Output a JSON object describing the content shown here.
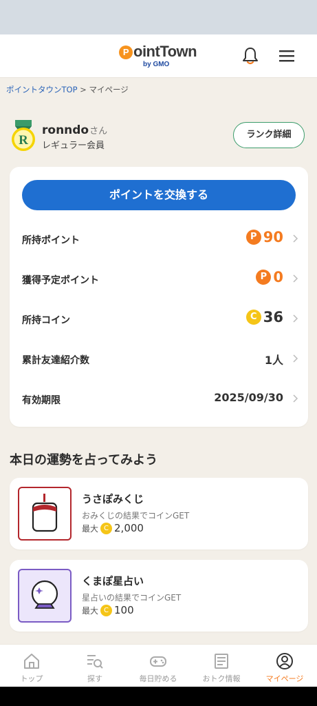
{
  "header": {
    "logo_main": "ointTown",
    "logo_p": "P",
    "logo_sub": "by GMO",
    "bell_icon": "bell-icon",
    "menu_icon": "hamburger-menu-icon"
  },
  "breadcrumb": {
    "home": "ポイントタウンTOP",
    "separator": " > ",
    "current": "マイページ"
  },
  "profile": {
    "badge_letter": "R",
    "name": "ronndo",
    "suffix": "さん",
    "rank": "レギュラー会員",
    "rank_button": "ランク詳細"
  },
  "points": {
    "exchange_button": "ポイントを交換する",
    "rows": [
      {
        "label": "所持ポイント",
        "value": "90",
        "unit_icon": "point-coin-icon"
      },
      {
        "label": "獲得予定ポイント",
        "value": "0",
        "unit_icon": "point-coin-icon"
      },
      {
        "label": "所持コイン",
        "value": "36",
        "unit_icon": "coin-icon"
      },
      {
        "label": "累計友達紹介数",
        "value": "1人"
      },
      {
        "label": "有効期限",
        "value": "2025/09/30"
      }
    ],
    "point_badge": "P",
    "coin_badge": "C"
  },
  "fortune": {
    "title": "本日の運勢を占ってみよう",
    "items": [
      {
        "title": "うさぽみくじ",
        "desc": "おみくじの結果でコインGET",
        "max_label": "最大",
        "amount": "2,000",
        "icon": "omikuji-box-icon"
      },
      {
        "title": "くまぽ星占い",
        "desc": "星占いの結果でコインGET",
        "max_label": "最大",
        "amount": "100",
        "icon": "crystal-ball-icon"
      }
    ]
  },
  "nav": [
    {
      "label": "トップ",
      "icon": "home-icon"
    },
    {
      "label": "探す",
      "icon": "search-list-icon"
    },
    {
      "label": "毎日貯める",
      "icon": "gamepad-icon"
    },
    {
      "label": "おトク情報",
      "icon": "newspaper-icon"
    },
    {
      "label": "マイページ",
      "icon": "user-circle-icon",
      "active": true
    }
  ],
  "colors": {
    "accent_orange": "#f47b20",
    "primary_blue": "#1f6fd1",
    "coin_yellow": "#f5c518",
    "rank_green": "#3a9b6a"
  }
}
